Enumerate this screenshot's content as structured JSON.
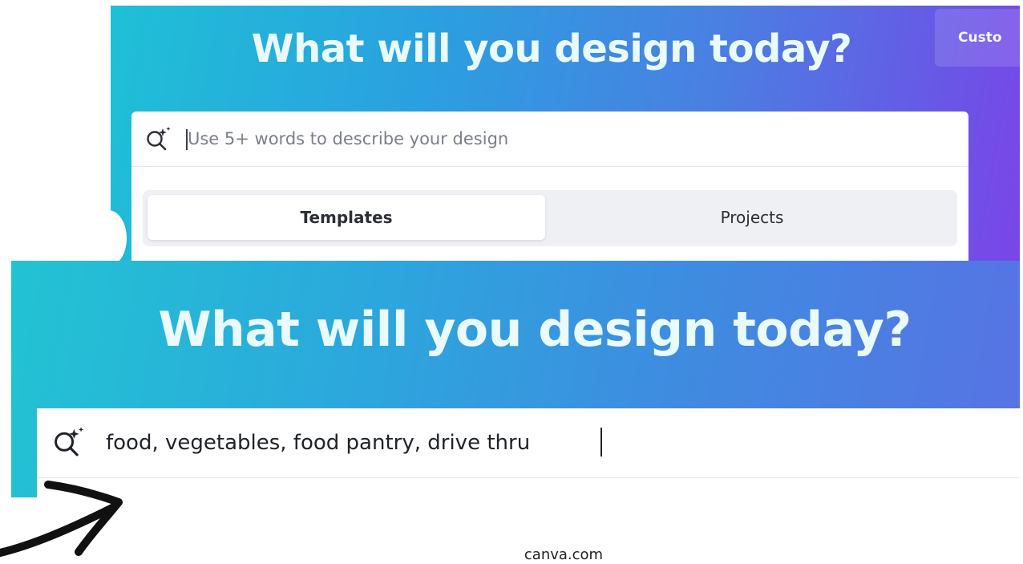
{
  "top_panel": {
    "headline": "What will you design today?",
    "custom_button_label": "Custo",
    "search": {
      "placeholder": "Use 5+ words to describe your design",
      "value": ""
    },
    "tabs": [
      {
        "label": "Templates",
        "active": true
      },
      {
        "label": "Projects",
        "active": false
      }
    ]
  },
  "bottom_panel": {
    "headline": "What will you design today?",
    "search": {
      "placeholder": "",
      "value": "food, vegetables, food pantry, drive thru"
    }
  },
  "caption": "canva.com",
  "icons": {
    "search": "magic-search-icon",
    "arrow": "hand-drawn-arrow-icon"
  },
  "colors": {
    "gradient_start": "#1fc0d6",
    "gradient_mid": "#4a7fe2",
    "gradient_end": "#7b45e8",
    "headline": "#e9fbff"
  }
}
